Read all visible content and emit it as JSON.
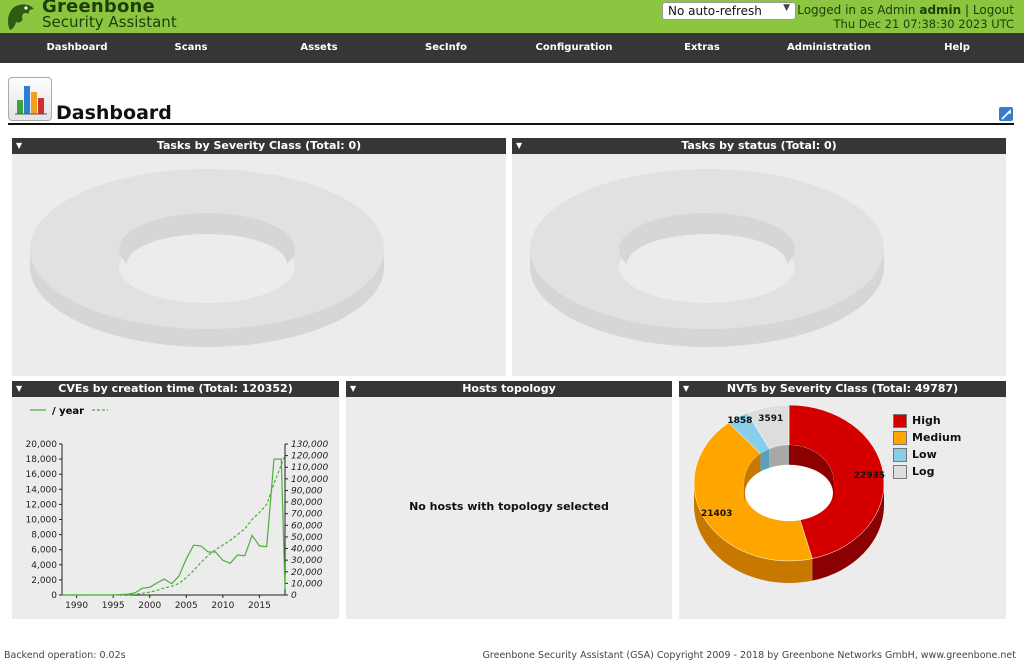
{
  "header": {
    "brand_line1": "Greenbone",
    "brand_line2": "Security Assistant",
    "refresh_select": "No auto-refresh",
    "logged_in_prefix": "Logged in as  Admin ",
    "username": "admin",
    "separator": "|",
    "logout": "Logout",
    "datetime": "Thu Dec 21 07:38:30 2023 UTC",
    "logo_color": "#8cc540"
  },
  "nav": [
    "Dashboard",
    "Scans",
    "Assets",
    "SecInfo",
    "Configuration",
    "Extras",
    "Administration",
    "Help"
  ],
  "page": {
    "title": "Dashboard"
  },
  "panels": {
    "tasks_severity": {
      "title": "Tasks by Severity Class (Total: 0)"
    },
    "tasks_status": {
      "title": "Tasks by status (Total: 0)"
    },
    "cves": {
      "title": "CVEs by creation time (Total: 120352)",
      "legend_label": "/ year"
    },
    "hosts_topology": {
      "title": "Hosts topology",
      "message": "No hosts with topology selected"
    },
    "nvts": {
      "title": "NVTs by Severity Class (Total: 49787)"
    }
  },
  "chart_data": [
    {
      "type": "line",
      "title": "CVEs by creation time (Total: 120352)",
      "x": [
        1988,
        1990,
        1995,
        1997,
        1998,
        1999,
        2000,
        2001,
        2002,
        2003,
        2004,
        2005,
        2006,
        2007,
        2008,
        2009,
        2010,
        2011,
        2012,
        2013,
        2014,
        2015,
        2016,
        2017,
        2018,
        2018.5
      ],
      "series": [
        {
          "name": "/ year",
          "axis": "left",
          "values": [
            0,
            0,
            0,
            100,
            300,
            900,
            1000,
            1600,
            2100,
            1500,
            2500,
            4800,
            6600,
            6500,
            5700,
            5700,
            4600,
            4200,
            5300,
            5200,
            7900,
            6500,
            6400,
            18000,
            18000,
            800
          ]
        },
        {
          "name": "",
          "axis": "right",
          "style": "dashed",
          "values": [
            0,
            0,
            100,
            200,
            500,
            1500,
            2500,
            4000,
            6000,
            7500,
            10000,
            15000,
            21000,
            28000,
            34000,
            39000,
            43000,
            47000,
            52000,
            57000,
            65000,
            71000,
            78000,
            96000,
            112000,
            120352
          ]
        }
      ],
      "xticks": [
        1990,
        1995,
        2000,
        2005,
        2010,
        2015
      ],
      "xlim": [
        1988,
        2018.5
      ],
      "ylim": [
        0,
        20000
      ],
      "yticks_left": [
        "0",
        "2,000",
        "4,000",
        "6,000",
        "8,000",
        "10,000",
        "12,000",
        "14,000",
        "16,000",
        "18,000",
        "20,000"
      ],
      "y2lim": [
        0,
        130000
      ],
      "yticks_right": [
        "0",
        "10,000",
        "20,000",
        "30,000",
        "40,000",
        "50,000",
        "60,000",
        "70,000",
        "80,000",
        "90,000",
        "100,000",
        "110,000",
        "120,000",
        "130,000"
      ],
      "line_color": "#4caf3a",
      "legend_position": "top-left"
    },
    {
      "type": "pie",
      "title": "NVTs by Severity Class (Total: 49787)",
      "labels": [
        "High",
        "Medium",
        "Low",
        "Log"
      ],
      "values": [
        22935,
        21403,
        1858,
        3591
      ],
      "colors": [
        "#d40000",
        "#ffa500",
        "#87ceeb",
        "#dddddd"
      ],
      "style": "3d-donut",
      "legend_position": "right"
    }
  ]
}
